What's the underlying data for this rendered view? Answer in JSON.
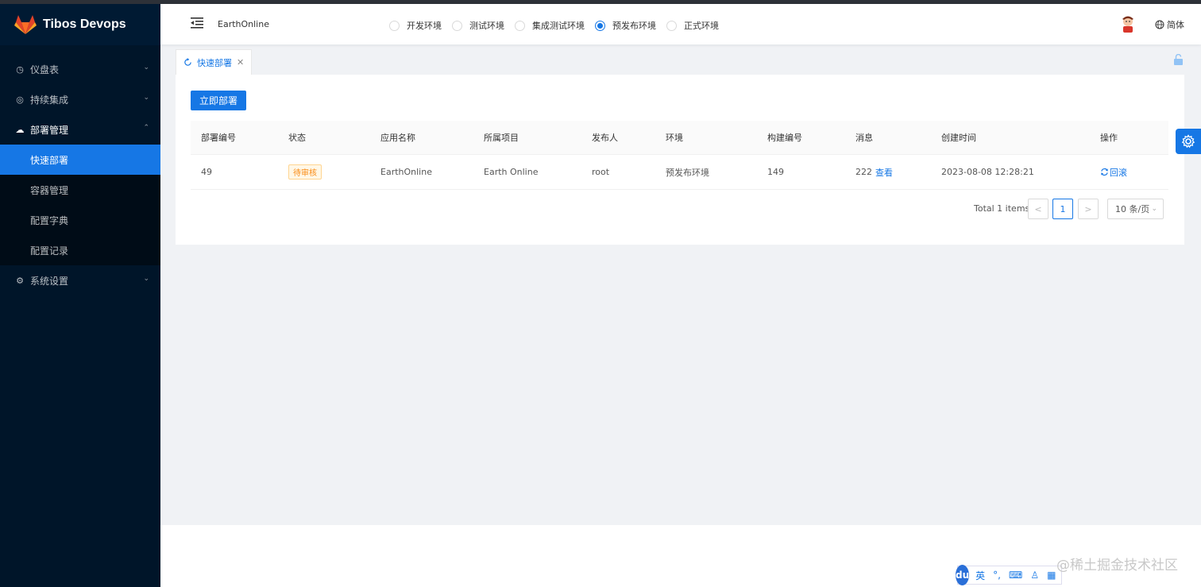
{
  "sidebar": {
    "logo_text": "Tibos Devops",
    "items": [
      {
        "label": "仪盘表"
      },
      {
        "label": "持续集成"
      },
      {
        "label": "部署管理"
      },
      {
        "label": "系统设置"
      }
    ],
    "sub_items": [
      {
        "label": "快速部署"
      },
      {
        "label": "容器管理"
      },
      {
        "label": "配置字典"
      },
      {
        "label": "配置记录"
      }
    ]
  },
  "header": {
    "project": "EarthOnline",
    "envs": [
      {
        "label": "开发环境",
        "checked": false
      },
      {
        "label": "测试环境",
        "checked": false
      },
      {
        "label": "集成测试环境",
        "checked": false
      },
      {
        "label": "预发布环境",
        "checked": true
      },
      {
        "label": "正式环境",
        "checked": false
      }
    ],
    "lang": "简体"
  },
  "tabs": [
    {
      "label": "快速部署"
    }
  ],
  "toolbar": {
    "deploy_label": "立即部署"
  },
  "table": {
    "columns": [
      "部署编号",
      "状态",
      "应用名称",
      "所属项目",
      "发布人",
      "环境",
      "构建编号",
      "消息",
      "创建时间",
      "操作"
    ],
    "rows": [
      {
        "id": "49",
        "status": "待审核",
        "app": "EarthOnline",
        "project": "Earth Online",
        "publisher": "root",
        "env": "预发布环境",
        "build": "149",
        "message": "222",
        "message_link": "查看",
        "created": "2023-08-08 12:28:21",
        "action": "回滚"
      }
    ]
  },
  "pagination": {
    "total": "Total 1 items",
    "current": "1",
    "page_size": "10 条/页"
  },
  "ime": {
    "logo": "du",
    "lang": "英"
  },
  "watermark": "@稀土掘金技术社区",
  "colors": {
    "primary": "#1677e5",
    "sidebar": "#001529",
    "tag": "#fa8c16"
  }
}
